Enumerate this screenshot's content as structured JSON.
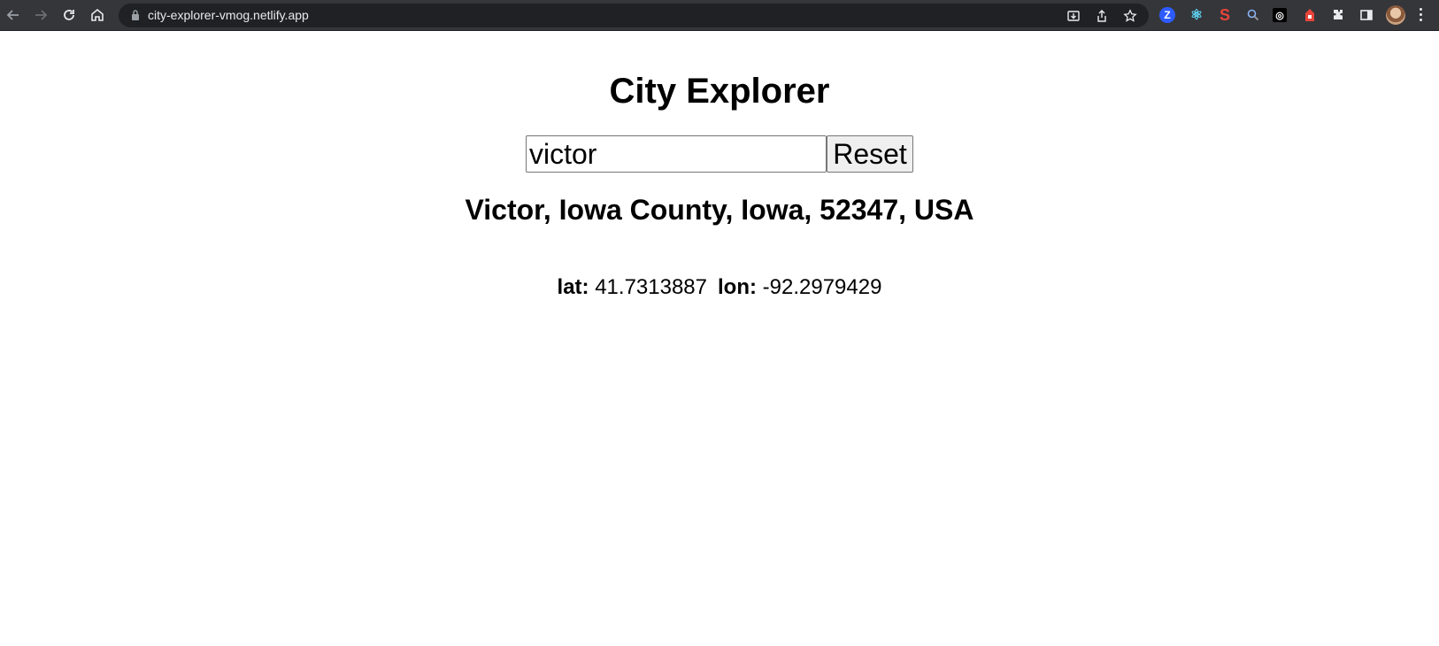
{
  "browser": {
    "url": "city-explorer-vmog.netlify.app",
    "icons": [
      "back-arrow-icon",
      "forward-arrow-icon",
      "reload-icon",
      "home-icon",
      "lock-icon",
      "install-icon",
      "share-icon",
      "star-icon",
      "extensions-icon",
      "side-panel-icon",
      "profile-avatar",
      "menu-icon"
    ],
    "extensions": [
      {
        "name": "zoom-extension-icon",
        "glyph": "Z",
        "color": "#2d5bff"
      },
      {
        "name": "react-devtools-icon",
        "glyph": "⚛",
        "color": "#61dafb"
      },
      {
        "name": "s-extension-icon",
        "glyph": "S",
        "color": "#e8443a"
      },
      {
        "name": "magnifier-extension-icon",
        "glyph": "🔍",
        "color": "#9aa0a6"
      },
      {
        "name": "openai-extension-icon",
        "glyph": "◎",
        "color": "#000000"
      },
      {
        "name": "red-extension-icon",
        "glyph": "▲",
        "color": "#e8443a"
      }
    ]
  },
  "app": {
    "title": "City Explorer",
    "search": {
      "value": "victor"
    },
    "reset_label": "Reset",
    "result": {
      "display_name": "Victor, Iowa County, Iowa, 52347, USA",
      "lat_label": "lat:",
      "lat": "41.7313887",
      "lon_label": "lon:",
      "lon": "-92.2979429"
    }
  }
}
